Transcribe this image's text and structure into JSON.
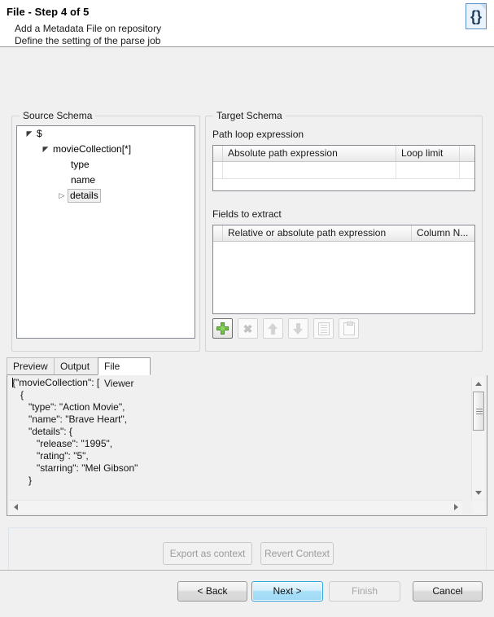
{
  "header": {
    "title_main": "File",
    "title_sep": " - ",
    "title_step": "Step 4 of 5",
    "subtitle_line1": "Add a Metadata File on repository",
    "subtitle_line2": "Define the setting of the parse job",
    "icon": "json-file-icon",
    "icon_glyph": "{}"
  },
  "source_schema": {
    "title": "Source Schema",
    "tree": [
      {
        "label": "$",
        "twisty": "expanded",
        "indent": 0,
        "selected": false
      },
      {
        "label": "movieCollection[*]",
        "twisty": "expanded",
        "indent": 1,
        "selected": false
      },
      {
        "label": "type",
        "twisty": "none",
        "indent": 3,
        "selected": false
      },
      {
        "label": "name",
        "twisty": "none",
        "indent": 3,
        "selected": false
      },
      {
        "label": "details",
        "twisty": "collapsed",
        "indent": 2,
        "selected": true
      }
    ]
  },
  "target_schema": {
    "title": "Target Schema",
    "path_loop": {
      "label": "Path loop expression",
      "columns": [
        "",
        "Absolute path expression",
        "Loop limit",
        ""
      ],
      "rows": [
        [
          "",
          "",
          "",
          ""
        ]
      ]
    },
    "fields_to_extract": {
      "label": "Fields to extract",
      "columns": [
        "",
        "Relative or absolute path expression",
        "Column N...",
        ""
      ],
      "rows": []
    },
    "toolbar": [
      {
        "name": "add-button",
        "icon": "plus-icon",
        "enabled": true
      },
      {
        "name": "delete-button",
        "icon": "close-x-icon",
        "enabled": false
      },
      {
        "name": "move-up-button",
        "icon": "arrow-up-icon",
        "enabled": false
      },
      {
        "name": "move-down-button",
        "icon": "arrow-down-icon",
        "enabled": false
      },
      {
        "name": "copy-button",
        "icon": "copy-icon",
        "enabled": false
      },
      {
        "name": "paste-button",
        "icon": "paste-icon",
        "enabled": false
      }
    ]
  },
  "viewer": {
    "tabs": [
      {
        "label": "Preview",
        "active": false
      },
      {
        "label": "Output",
        "active": false
      },
      {
        "label": "File Viewer",
        "active": true
      }
    ],
    "code_lines": [
      "{\"movieCollection\": [",
      "   {",
      "      \"type\": \"Action Movie\",",
      "      \"name\": \"Brave Heart\",",
      "      \"details\": {",
      "         \"release\": \"1995\",",
      "         \"rating\": \"5\",",
      "         \"starring\": \"Mel Gibson\"",
      "      }"
    ]
  },
  "context_actions": {
    "export_label": "Export as context",
    "revert_label": "Revert Context"
  },
  "footer": {
    "back_label": "< Back",
    "next_label": "Next >",
    "finish_label": "Finish",
    "cancel_label": "Cancel"
  },
  "colors": {
    "accent": "#2fa4d8",
    "panel_bg": "#f0f0f0",
    "plus_green": "#74bd4a"
  }
}
